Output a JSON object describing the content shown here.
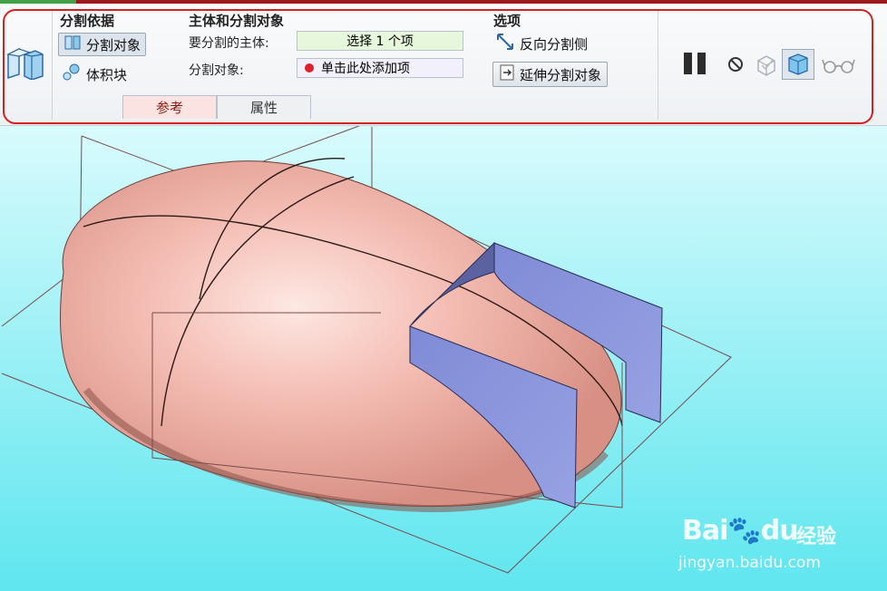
{
  "colors": {
    "highlight": "#d42020",
    "active_tab_bg": "#fbe3e1",
    "active_tab_text": "#8a1d14",
    "body_fill": "#f3b6ab",
    "cut_surface": "#8a96dc",
    "bg_top": "#d9fbfd",
    "bg_bottom": "#5fe6ef"
  },
  "split_by": {
    "title": "分割依据",
    "split_object_button": "分割对象",
    "split_object_icon": "split-object-icon",
    "volume_block_button": "体积块",
    "volume_block_icon": "volume-block-icon"
  },
  "body_and_split": {
    "title": "主体和分割对象",
    "body_label": "要分割的主体:",
    "body_value": "选择 1 个项",
    "split_label": "分割对象:",
    "split_value": "单击此处添加项"
  },
  "options": {
    "title": "选项",
    "flip_button": "反向分割侧",
    "flip_icon": "flip-side-icon",
    "extend_button": "延伸分割对象",
    "extend_icon": "extend-icon"
  },
  "tabs": [
    {
      "label": "参考",
      "active": true
    },
    {
      "label": "属性",
      "active": false
    }
  ],
  "toolbar_icons": [
    "feature-icon",
    "pause-icon",
    "no-preview-icon",
    "verify-icon",
    "preview-icon",
    "glasses-icon"
  ],
  "watermark": {
    "logo": "Bai",
    "logo_suffix": "du",
    "product": "经验",
    "url": "jingyan.baidu.com"
  }
}
